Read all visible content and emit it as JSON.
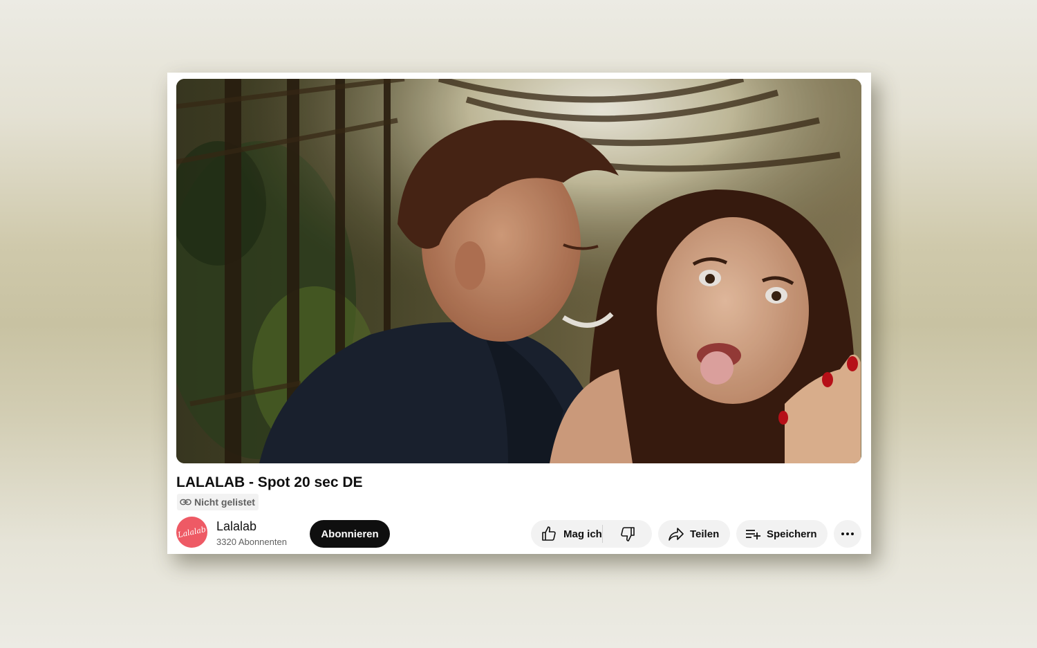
{
  "video": {
    "title": "LALALAB - Spot 20 sec DE",
    "visibility": "Nicht gelistet",
    "frame_description_icon": "video-frame"
  },
  "channel": {
    "name": "Lalalab",
    "subscribers": "3320 Abonnenten",
    "avatar_text": "Lalalab",
    "avatar_color": "#ee5a65"
  },
  "actions": {
    "subscribe_label": "Abonnieren",
    "like_label": "Mag ich",
    "share_label": "Teilen",
    "save_label": "Speichern"
  },
  "icons": {
    "visibility": "link-icon",
    "like": "thumbs-up-icon",
    "dislike": "thumbs-down-icon",
    "share": "share-arrow-icon",
    "save": "playlist-add-icon",
    "more": "more-horizontal-icon"
  },
  "colors": {
    "subscribe_bg": "#0f0f0f",
    "pill_bg": "#f2f2f2",
    "text_primary": "#0f0f0f",
    "text_secondary": "#606060"
  }
}
